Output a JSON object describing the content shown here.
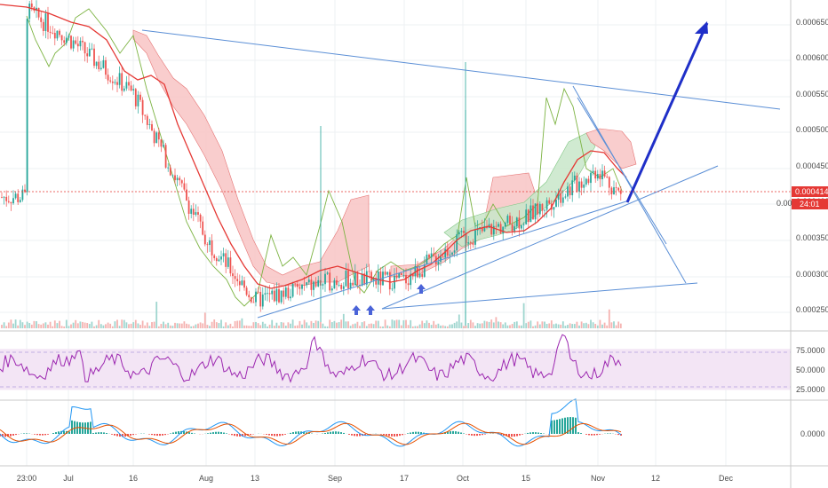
{
  "price_axis": {
    "ticks": [
      "0.0006500",
      "0.0006000",
      "0.0005500",
      "0.0005000",
      "0.0004500",
      "0.0004000",
      "0.0003500",
      "0.0003000",
      "0.0002500"
    ],
    "last_price": "0.0004141",
    "countdown": "24:01",
    "partial_label": "0.00"
  },
  "rsi_axis": {
    "ticks": [
      "75.0000",
      "50.0000",
      "25.0000"
    ]
  },
  "macd_axis": {
    "ticks": [
      "0.0000"
    ]
  },
  "time_axis": {
    "ticks": [
      "23:00",
      "Jul",
      "16",
      "Aug",
      "13",
      "Sep",
      "17",
      "Oct",
      "15",
      "Nov",
      "12",
      "Dec"
    ]
  },
  "colors": {
    "up": "#26a69a",
    "down": "#ef5350",
    "price_line": "#e53935",
    "cloud_red": "#f8c4c4",
    "cloud_green": "#c8e6c9",
    "trendline": "#5b8fd6",
    "arrow": "#1f2fc8",
    "lagging": "#7cb342",
    "rsi": "#9c27b0",
    "rsi_band": "#f3e5f5",
    "macd_fast": "#2196f3",
    "macd_signal": "#e65100"
  },
  "chart_data": {
    "type": "candlestick",
    "price_range": [
      0.00022,
      0.00069
    ],
    "price_points": [
      {
        "x": "23:00",
        "y": 0.00068
      },
      {
        "x": "Jul",
        "y": 0.00064
      },
      {
        "x": "16",
        "y": 0.00056
      },
      {
        "x": "Aug",
        "y": 0.00035
      },
      {
        "x": "13",
        "y": 0.00026
      },
      {
        "x": "Sep",
        "y": 0.00029
      },
      {
        "x": "17",
        "y": 0.00029
      },
      {
        "x": "Oct",
        "y": 0.00035
      },
      {
        "x": "15",
        "y": 0.00038
      },
      {
        "x": "Nov",
        "y": 0.00045
      },
      {
        "x": "Nov",
        "y": 0.00041
      }
    ],
    "last_price": 0.0004141,
    "rsi_range": [
      20,
      85
    ],
    "rsi_levels": [
      70,
      30
    ],
    "annotations": {
      "descending_resistance_trendline": [
        {
          "x": "16",
          "y": 0.000638
        },
        {
          "x": "Dec",
          "y": 0.00053
        }
      ],
      "ascending_support_trendline": [
        {
          "x": "Sep",
          "y": 0.000251
        },
        {
          "x": "Dec",
          "y": 0.00045
        }
      ],
      "projection_arrow_target": 0.00065
    }
  }
}
